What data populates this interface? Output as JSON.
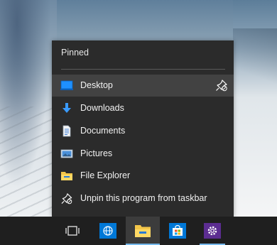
{
  "jumplist": {
    "section_title": "Pinned",
    "items": [
      {
        "label": "Desktop",
        "icon": "desktop-icon",
        "hovered": true
      },
      {
        "label": "Downloads",
        "icon": "downloads-icon"
      },
      {
        "label": "Documents",
        "icon": "documents-icon"
      },
      {
        "label": "Pictures",
        "icon": "pictures-icon"
      },
      {
        "label": "File Explorer",
        "icon": "file-explorer-icon"
      },
      {
        "label": "Unpin this program from taskbar",
        "icon": "unpin-icon"
      }
    ]
  },
  "taskbar": {
    "buttons": [
      {
        "icon": "task-view-icon"
      },
      {
        "icon": "edge-browser-icon"
      },
      {
        "icon": "file-explorer-icon",
        "active": true
      },
      {
        "icon": "store-icon"
      },
      {
        "icon": "settings-icon"
      }
    ]
  },
  "colors": {
    "menu_bg": "#2b2b2b",
    "hover_bg": "#424242",
    "taskbar_bg": "#1f1f1f",
    "accent": "#76b9ed",
    "store_blue": "#0078d7",
    "settings_purple": "#5c2d91"
  }
}
